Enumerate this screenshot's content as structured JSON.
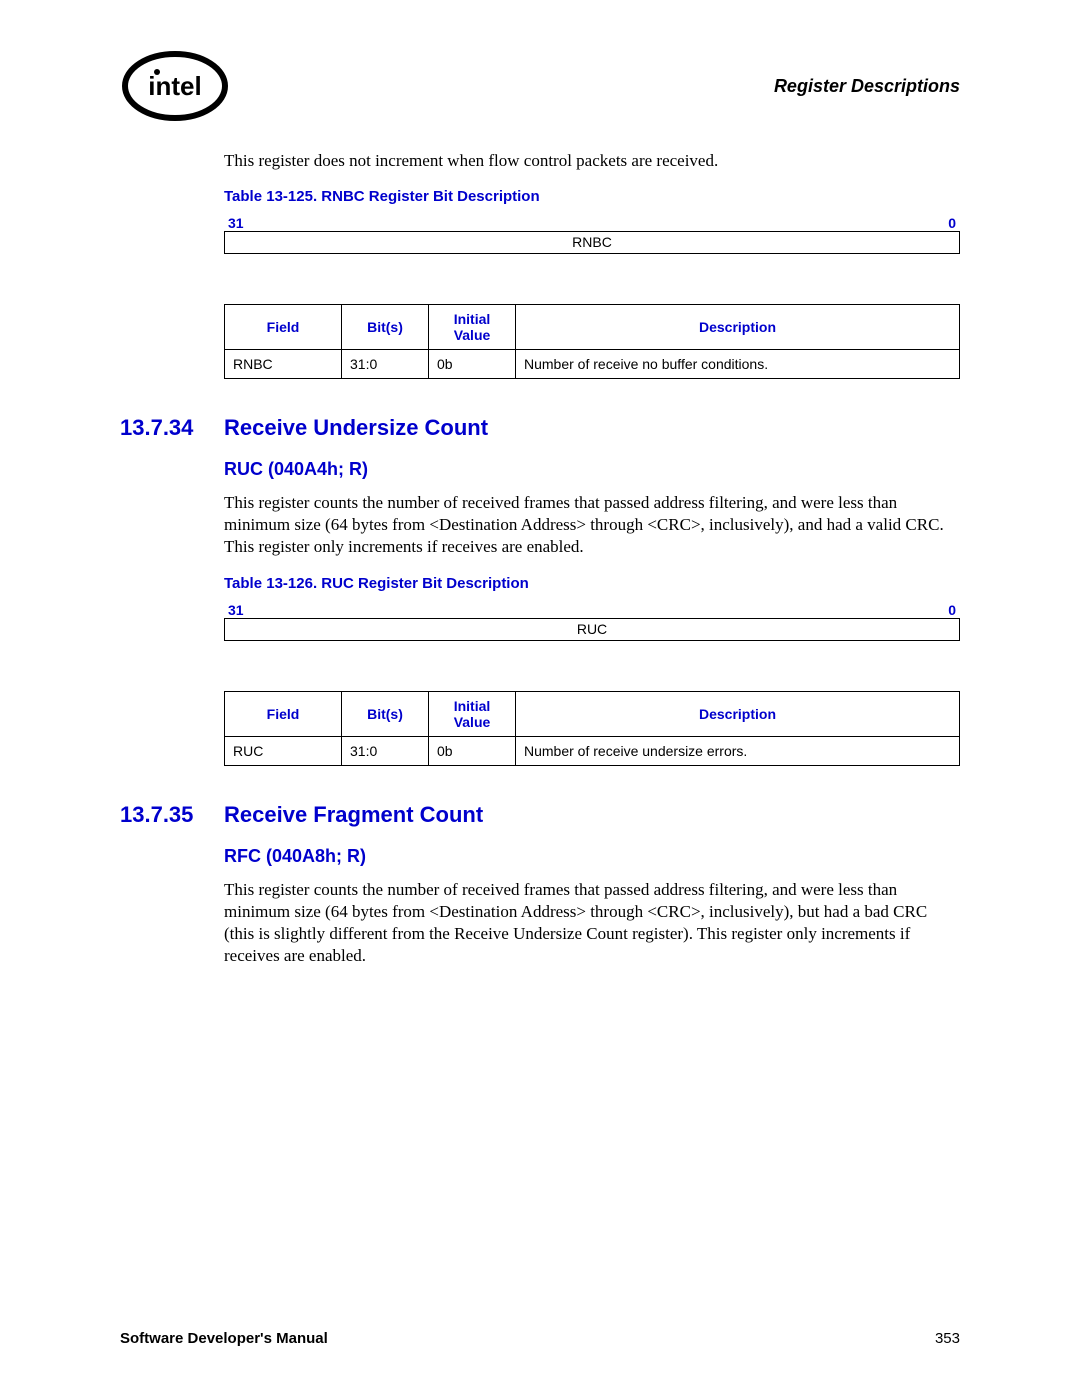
{
  "header": {
    "right_title": "Register Descriptions"
  },
  "intro_para": "This register does not increment when flow control packets are received.",
  "table125": {
    "caption": "Table 13-125. RNBC Register Bit Description",
    "bit_hi": "31",
    "bit_lo": "0",
    "reg_name": "RNBC",
    "headers": {
      "field": "Field",
      "bits": "Bit(s)",
      "init": "Initial Value",
      "desc": "Description"
    },
    "row": {
      "field": "RNBC",
      "bits": "31:0",
      "init": "0b",
      "desc": "Number of receive no buffer conditions."
    }
  },
  "sec34": {
    "num": "13.7.34",
    "title": "Receive Undersize Count",
    "sub": "RUC (040A4h; R)",
    "para": "This register counts the number of received frames that passed address filtering, and were less than minimum size (64 bytes from <Destination Address> through <CRC>, inclusively), and had a valid CRC. This register only increments if receives are enabled."
  },
  "table126": {
    "caption": "Table 13-126. RUC Register Bit Description",
    "bit_hi": "31",
    "bit_lo": "0",
    "reg_name": "RUC",
    "headers": {
      "field": "Field",
      "bits": "Bit(s)",
      "init": "Initial Value",
      "desc": "Description"
    },
    "row": {
      "field": "RUC",
      "bits": "31:0",
      "init": "0b",
      "desc": "Number of receive undersize errors."
    }
  },
  "sec35": {
    "num": "13.7.35",
    "title": "Receive Fragment Count",
    "sub": "RFC (040A8h; R)",
    "para": "This register counts the number of received frames that passed address filtering, and were less than minimum size (64 bytes from <Destination Address> through <CRC>, inclusively), but had a bad CRC (this is slightly different from the Receive Undersize Count register). This register only increments if receives are enabled."
  },
  "footer": {
    "left": "Software Developer's Manual",
    "right": "353"
  }
}
